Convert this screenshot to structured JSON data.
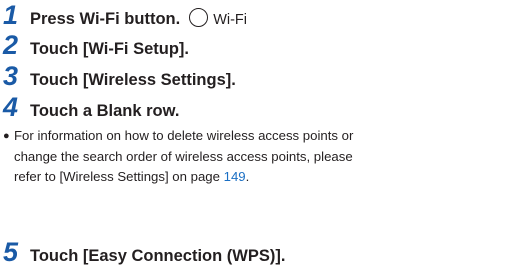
{
  "steps": [
    {
      "num": "1",
      "text": "Press Wi-Fi button.",
      "icon_label": "Wi-Fi"
    },
    {
      "num": "2",
      "text": "Touch [Wi-Fi Setup]."
    },
    {
      "num": "3",
      "text": "Touch [Wireless Settings]."
    },
    {
      "num": "4",
      "text": "Touch a Blank row."
    },
    {
      "num": "5",
      "text": "Touch [Easy Connection (WPS)]."
    }
  ],
  "note": {
    "bullet": "●",
    "line1": "For information on how to delete wireless access points or",
    "line2": "change the search order of wireless access points, please",
    "line3_prefix": "refer to [Wireless Settings] on page ",
    "page_link": "149",
    "line3_suffix": "."
  },
  "colors": {
    "step_number": "#1a5aa6",
    "text": "#231f20",
    "link": "#1a6fc4"
  },
  "icons": {
    "wifi_button": "circle-button-icon"
  }
}
